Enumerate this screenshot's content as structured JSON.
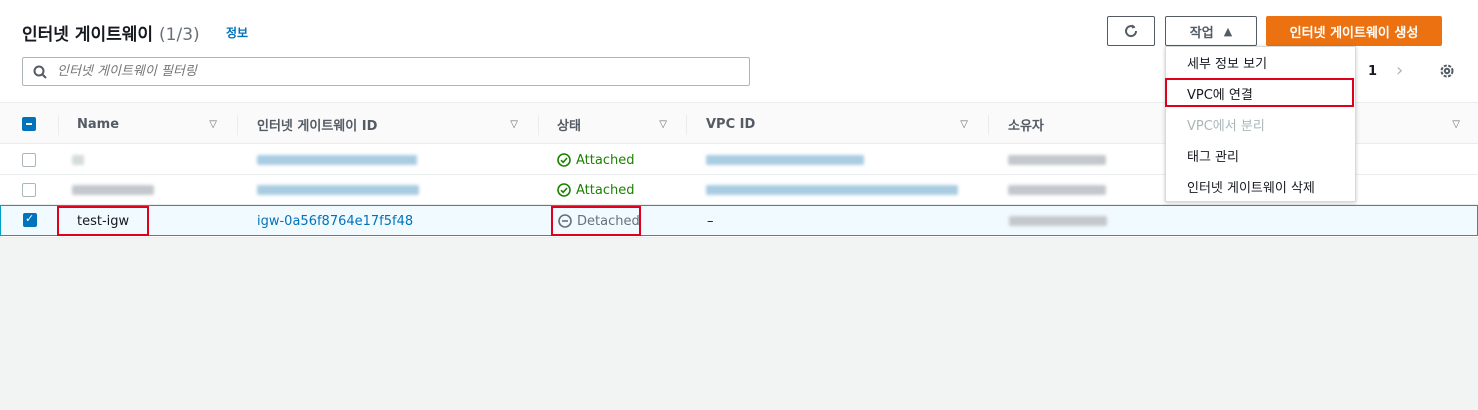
{
  "header": {
    "title": "인터넷 게이트웨이",
    "count": "(1/3)",
    "info": "정보"
  },
  "toolbar": {
    "actions_label": "작업",
    "create_label": "인터넷 게이트웨이 생성"
  },
  "search": {
    "placeholder": "인터넷 게이트웨이 필터링"
  },
  "pagination": {
    "page": "1"
  },
  "table": {
    "columns": [
      "Name",
      "인터넷 게이트웨이 ID",
      "상태",
      "VPC ID",
      "소유자"
    ],
    "rows": [
      {
        "name": "",
        "id": "",
        "status": "Attached",
        "vpc": "",
        "owner": "",
        "selected": false
      },
      {
        "name": "",
        "id": "",
        "status": "Attached",
        "vpc": "",
        "owner": "",
        "selected": false
      },
      {
        "name": "test-igw",
        "id": "igw-0a56f8764e17f5f48",
        "status": "Detached",
        "vpc": "–",
        "owner": "",
        "selected": true
      }
    ]
  },
  "menu": {
    "items": [
      {
        "label": "세부 정보 보기",
        "disabled": false
      },
      {
        "label": "VPC에 연결",
        "disabled": false
      },
      {
        "label": "VPC에서 분리",
        "disabled": true
      },
      {
        "label": "태그 관리",
        "disabled": false
      },
      {
        "label": "인터넷 게이트웨이 삭제",
        "disabled": false
      }
    ]
  },
  "colors": {
    "primary": "#ec7211",
    "link": "#0073bb",
    "ok": "#1d8102",
    "highlight": "#e0001b"
  },
  "icons": [
    "refresh-icon",
    "caret-up-icon",
    "search-icon",
    "chevron-right-icon",
    "gear-icon",
    "check-circle-icon",
    "minus-circle-icon",
    "sort-icon"
  ]
}
